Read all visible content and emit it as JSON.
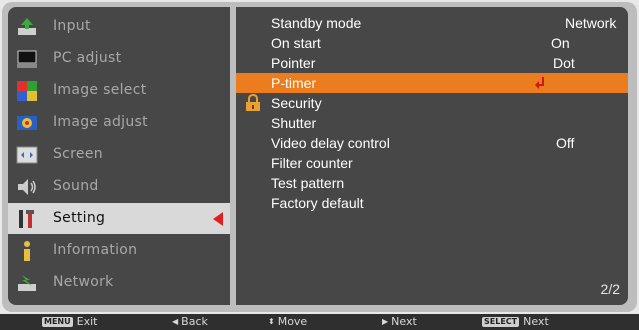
{
  "left_menu": {
    "items": [
      {
        "label": "Input",
        "icon": "input-icon"
      },
      {
        "label": "PC adjust",
        "icon": "pc-adjust-icon"
      },
      {
        "label": "Image select",
        "icon": "image-select-icon"
      },
      {
        "label": "Image adjust",
        "icon": "image-adjust-icon"
      },
      {
        "label": "Screen",
        "icon": "screen-icon"
      },
      {
        "label": "Sound",
        "icon": "sound-icon"
      },
      {
        "label": "Setting",
        "icon": "setting-icon"
      },
      {
        "label": "Information",
        "icon": "information-icon"
      },
      {
        "label": "Network",
        "icon": "network-icon"
      }
    ],
    "active_index": 6
  },
  "right_menu": {
    "items": [
      {
        "name": "Standby mode",
        "value": "Network"
      },
      {
        "name": "On start",
        "value": "On"
      },
      {
        "name": "Pointer",
        "value": "Dot"
      },
      {
        "name": "P-timer",
        "value": ""
      },
      {
        "name": "Security",
        "value": ""
      },
      {
        "name": "Shutter",
        "value": ""
      },
      {
        "name": "Video delay control",
        "value": "Off"
      },
      {
        "name": "Filter counter",
        "value": ""
      },
      {
        "name": "Test pattern",
        "value": ""
      },
      {
        "name": "Factory default",
        "value": ""
      }
    ],
    "selected_index": 3,
    "page": "2/2"
  },
  "footer": {
    "exit_key": "MENU",
    "exit": "Exit",
    "back": "Back",
    "move": "Move",
    "next": "Next",
    "select_key": "SELECT",
    "select_next": "Next"
  },
  "colors": {
    "highlight": "#ec7d1e",
    "panel": "#474747",
    "arrow": "#e02020"
  }
}
